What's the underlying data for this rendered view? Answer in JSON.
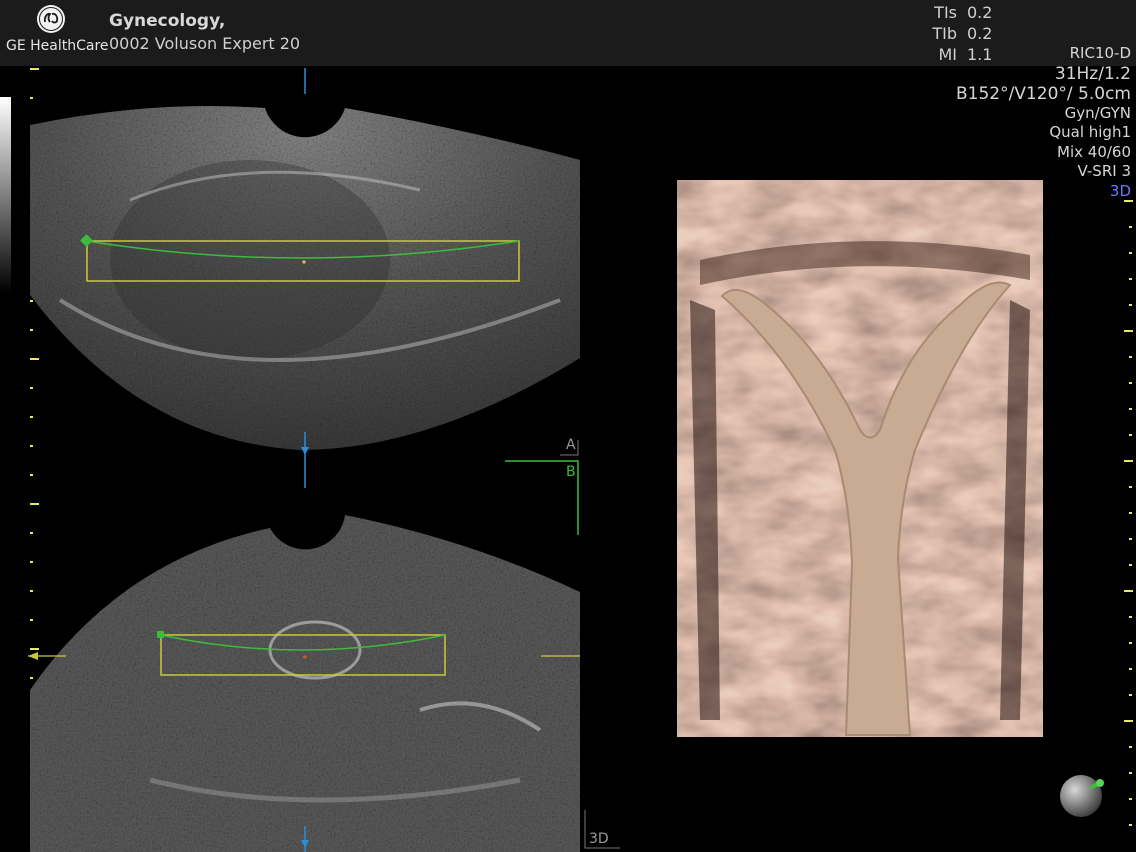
{
  "header": {
    "brand": "GE HealthCare",
    "exam_title": "Gynecology,",
    "device": "0002 Voluson Expert 20"
  },
  "params": [
    {
      "label": "TIs",
      "value": "0.2"
    },
    {
      "label": "TIb",
      "value": "0.2"
    },
    {
      "label": "MI",
      "value": "1.1"
    }
  ],
  "probe": {
    "transducer": "RIC10-D",
    "frame_rate": "31Hz/1.2",
    "angles_depth": "B152°/V120°/ 5.0cm",
    "application": "Gyn/GYN",
    "quality": "Qual high1",
    "mix": "Mix 40/60",
    "srl": "V-SRI 3",
    "mode": "3D"
  },
  "quadrants": {
    "a": "A",
    "b": "B",
    "render": "3D"
  },
  "colors": {
    "roi_curve": "#3dbb3d",
    "roi_box": "#c9c93a",
    "mode_3d": "#6d78ff",
    "marker": "#2a8fd6",
    "scale_tick": "#e8e86a"
  },
  "icons": [
    "ge-logo-icon",
    "orientation-sphere-icon"
  ]
}
